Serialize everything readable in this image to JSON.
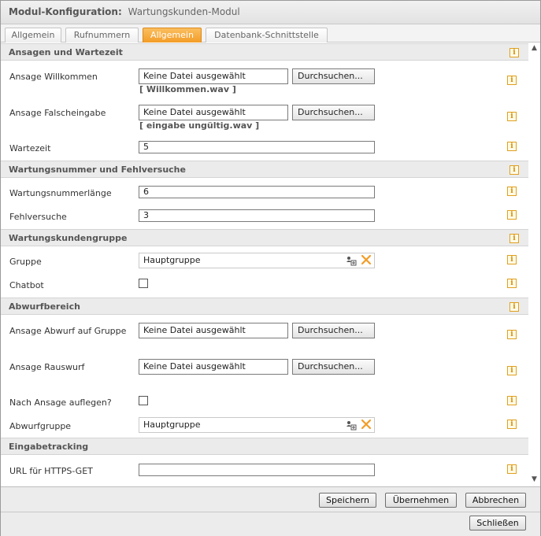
{
  "window": {
    "title_bold": "Modul-Konfiguration:",
    "title_name": "Wartungskunden-Modul"
  },
  "tabs": [
    {
      "label": "Allgemein",
      "active": false
    },
    {
      "label": "Rufnummern",
      "active": false
    },
    {
      "label": "Allgemein",
      "active": true
    },
    {
      "label": "Datenbank-Schnittstelle",
      "active": false
    }
  ],
  "common": {
    "no_file": "Keine Datei ausgewählt",
    "browse": "Durchsuchen...",
    "info_glyph": "i",
    "pick_icon": "user-group-picker-icon",
    "clear_icon": "close-x-icon",
    "accent_color": "#f5a431"
  },
  "sections": {
    "ansagen": {
      "title": "Ansagen und Wartezeit",
      "willkommen_label": "Ansage Willkommen",
      "willkommen_file": "[ Willkommen.wav ]",
      "falsch_label": "Ansage Falscheingabe",
      "falsch_file": "[ eingabe ungültig.wav ]",
      "wartezeit_label": "Wartezeit",
      "wartezeit_value": "5"
    },
    "wartungsnummer": {
      "title": "Wartungsnummer und Fehlversuche",
      "laenge_label": "Wartungsnummerlänge",
      "laenge_value": "6",
      "fehl_label": "Fehlversuche",
      "fehl_value": "3"
    },
    "gruppe": {
      "title": "Wartungskundengruppe",
      "gruppe_label": "Gruppe",
      "gruppe_value": "Hauptgruppe",
      "chatbot_label": "Chatbot",
      "chatbot_checked": false
    },
    "abwurf": {
      "title": "Abwurfbereich",
      "abwurf_label": "Ansage Abwurf auf Gruppe",
      "rauswurf_label": "Ansage Rauswurf",
      "auflegen_label": "Nach Ansage auflegen?",
      "auflegen_checked": false,
      "abwurfgruppe_label": "Abwurfgruppe",
      "abwurfgruppe_value": "Hauptgruppe"
    },
    "tracking": {
      "title": "Eingabetracking",
      "url_label": "URL für HTTPS-GET",
      "url_value": ""
    }
  },
  "footer": {
    "save": "Speichern",
    "apply": "Übernehmen",
    "cancel": "Abbrechen",
    "close": "Schließen"
  }
}
